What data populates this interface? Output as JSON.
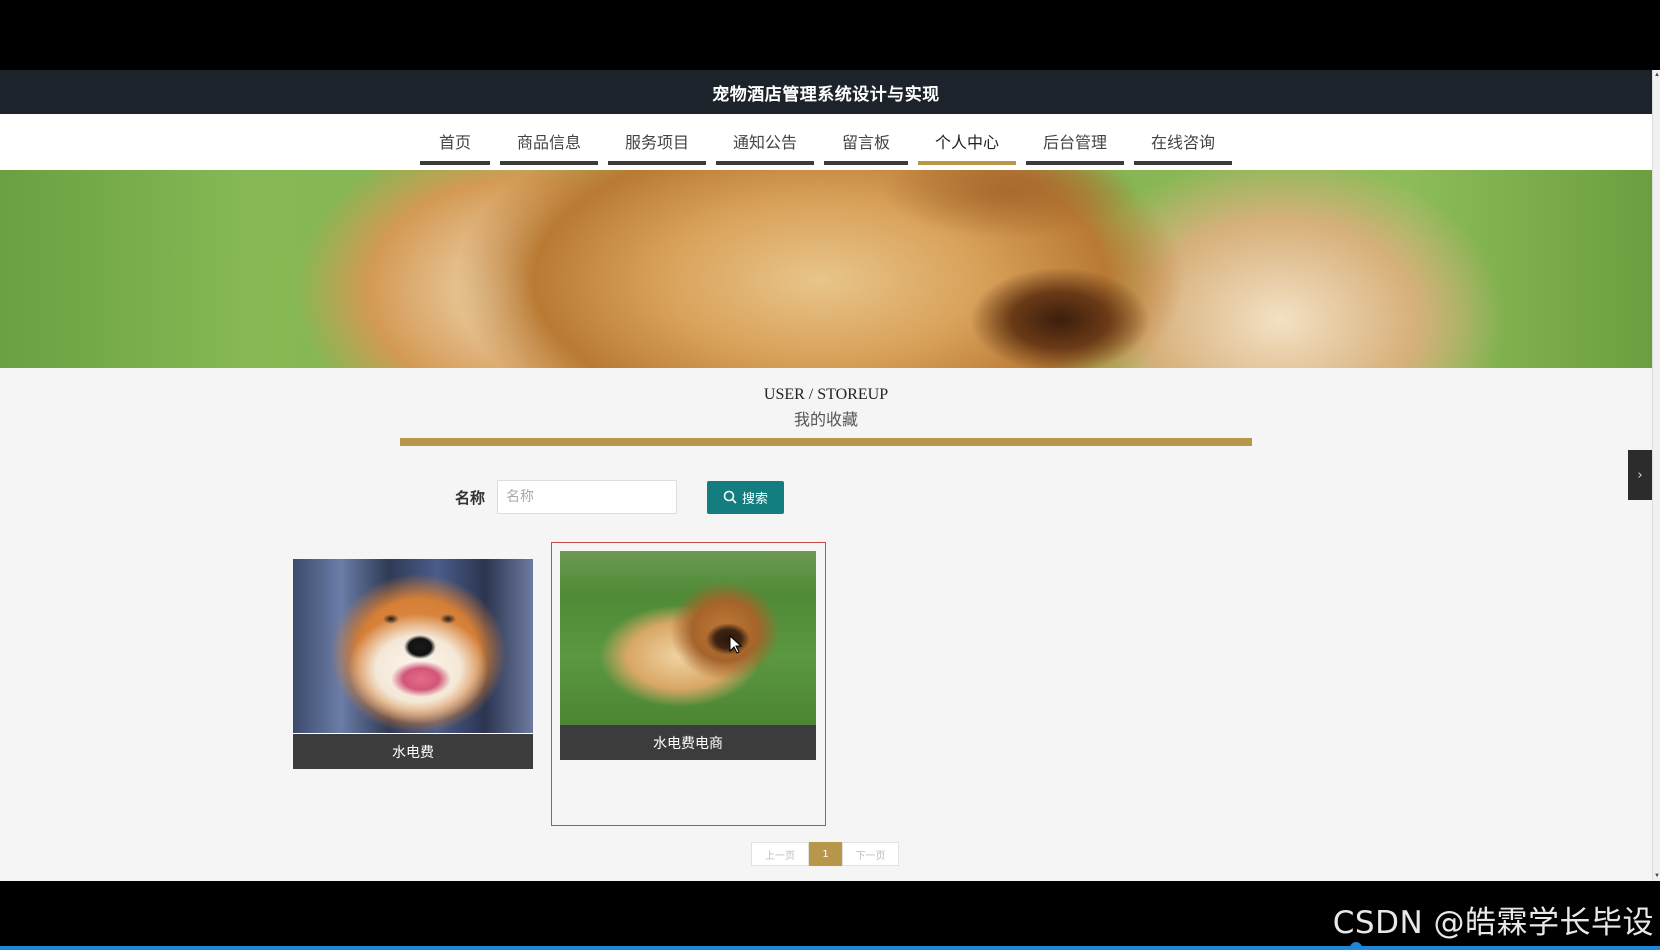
{
  "site": {
    "title": "宠物酒店管理系统设计与实现",
    "nav": [
      {
        "label": "首页",
        "active": false
      },
      {
        "label": "商品信息",
        "active": false
      },
      {
        "label": "服务项目",
        "active": false
      },
      {
        "label": "通知公告",
        "active": false
      },
      {
        "label": "留言板",
        "active": false
      },
      {
        "label": "个人中心",
        "active": true
      },
      {
        "label": "后台管理",
        "active": false
      },
      {
        "label": "在线咨询",
        "active": false
      }
    ],
    "section": {
      "en": "USER / STOREUP",
      "cn": "我的收藏"
    },
    "search": {
      "label": "名称",
      "placeholder": "名称",
      "value": "",
      "button_label": "搜索"
    },
    "favorites": [
      {
        "caption": "水电费",
        "image": "shiba-inu-photo",
        "selected": false
      },
      {
        "caption": "水电费电商",
        "image": "chow-chow-photo",
        "selected": true
      }
    ],
    "pagination": {
      "prev_label": "上一页",
      "current_page": "1",
      "next_label": "下一页"
    },
    "side_tab_label": "›"
  },
  "colors": {
    "title_bar": "#1d232b",
    "accent_gold": "#b8964a",
    "search_button": "#147d7f",
    "caption_bg": "#3c3c3c",
    "selected_border": "#c94a4a"
  },
  "watermark": "CSDN @皓霖学长毕设"
}
